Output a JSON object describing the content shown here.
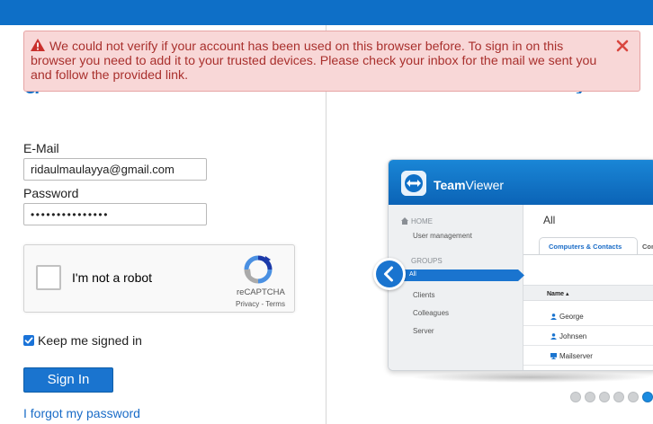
{
  "alert": {
    "message": "We could not verify if your account has been used on this browser before. To sign in on this browser you need to add it to your trusted devices. Please check your inbox for the mail we sent you and follow the provided link."
  },
  "login": {
    "email_label": "E-Mail",
    "email_value": "ridaulmaulayya@gmail.com",
    "password_label": "Password",
    "password_value": "•••••••••••••••",
    "keep_signed_in_label": "Keep me signed in",
    "keep_signed_in_checked": true,
    "signin_label": "Sign In",
    "forgot_label": "I forgot my password"
  },
  "recaptcha": {
    "label": "I'm not a robot",
    "brand": "reCAPTCHA",
    "links": "Privacy - Terms"
  },
  "showcase": {
    "app_title_bold": "Team",
    "app_title_rest": "Viewer",
    "home_label": "HOME",
    "user_management": "User management",
    "groups_label": "GROUPS",
    "groups": [
      "All",
      "Clients",
      "Colleagues",
      "Server"
    ],
    "main_title": "All",
    "tab_active": "Computers & Contacts",
    "tab_other": "Con",
    "col_name": "Name ▴",
    "rows": [
      "George",
      "Johnsen",
      "Mailserver"
    ],
    "dots_total": 7,
    "dots_active_index": 5
  },
  "colors": {
    "brand_blue": "#0e6fc7",
    "alert_bg": "#f8d7d7",
    "alert_text": "#a9302d"
  }
}
